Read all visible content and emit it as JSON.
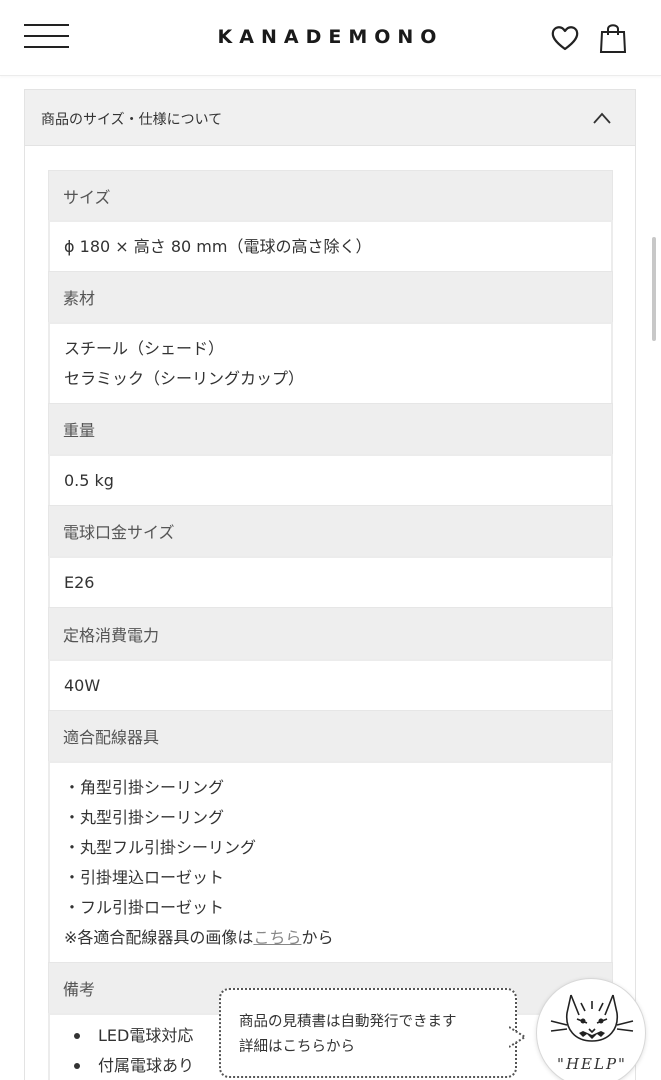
{
  "header": {
    "brand": "KANADEMONO",
    "icons": {
      "menu": "hamburger-menu-icon",
      "favorite": "heart-icon",
      "cart": "shopping-bag-icon"
    }
  },
  "accordion": {
    "title": "商品のサイズ・仕様について",
    "state": "expanded"
  },
  "specs": {
    "size_label": "サイズ",
    "size_value": "ϕ 180 × 高さ 80 mm（電球の高さ除く）",
    "material_label": "素材",
    "material_value_1": "スチール（シェード）",
    "material_value_2": "セラミック（シーリングカップ）",
    "weight_label": "重量",
    "weight_value": "0.5 kg",
    "socket_label": "電球口金サイズ",
    "socket_value": "E26",
    "power_label": "定格消費電力",
    "power_value": "40W",
    "fixture_label": "適合配線器具",
    "fixtures": [
      "・角型引掛シーリング",
      "・丸型引掛シーリング",
      "・丸型フル引掛シーリング",
      "・引掛埋込ローゼット",
      "・フル引掛ローゼット"
    ],
    "fixture_note_prefix": "※各適合配線器具の画像は",
    "fixture_note_link": "こちら",
    "fixture_note_suffix": "から",
    "remarks_label": "備考",
    "remarks": [
      "LED電球対応",
      "付属電球あり"
    ]
  },
  "chat_tip": {
    "line_1": "商品の見積書は自動発行できます",
    "line_2": "詳細はこちらから"
  },
  "help_button": {
    "label": "\"HELP\"",
    "icon": "cat-face-icon"
  }
}
